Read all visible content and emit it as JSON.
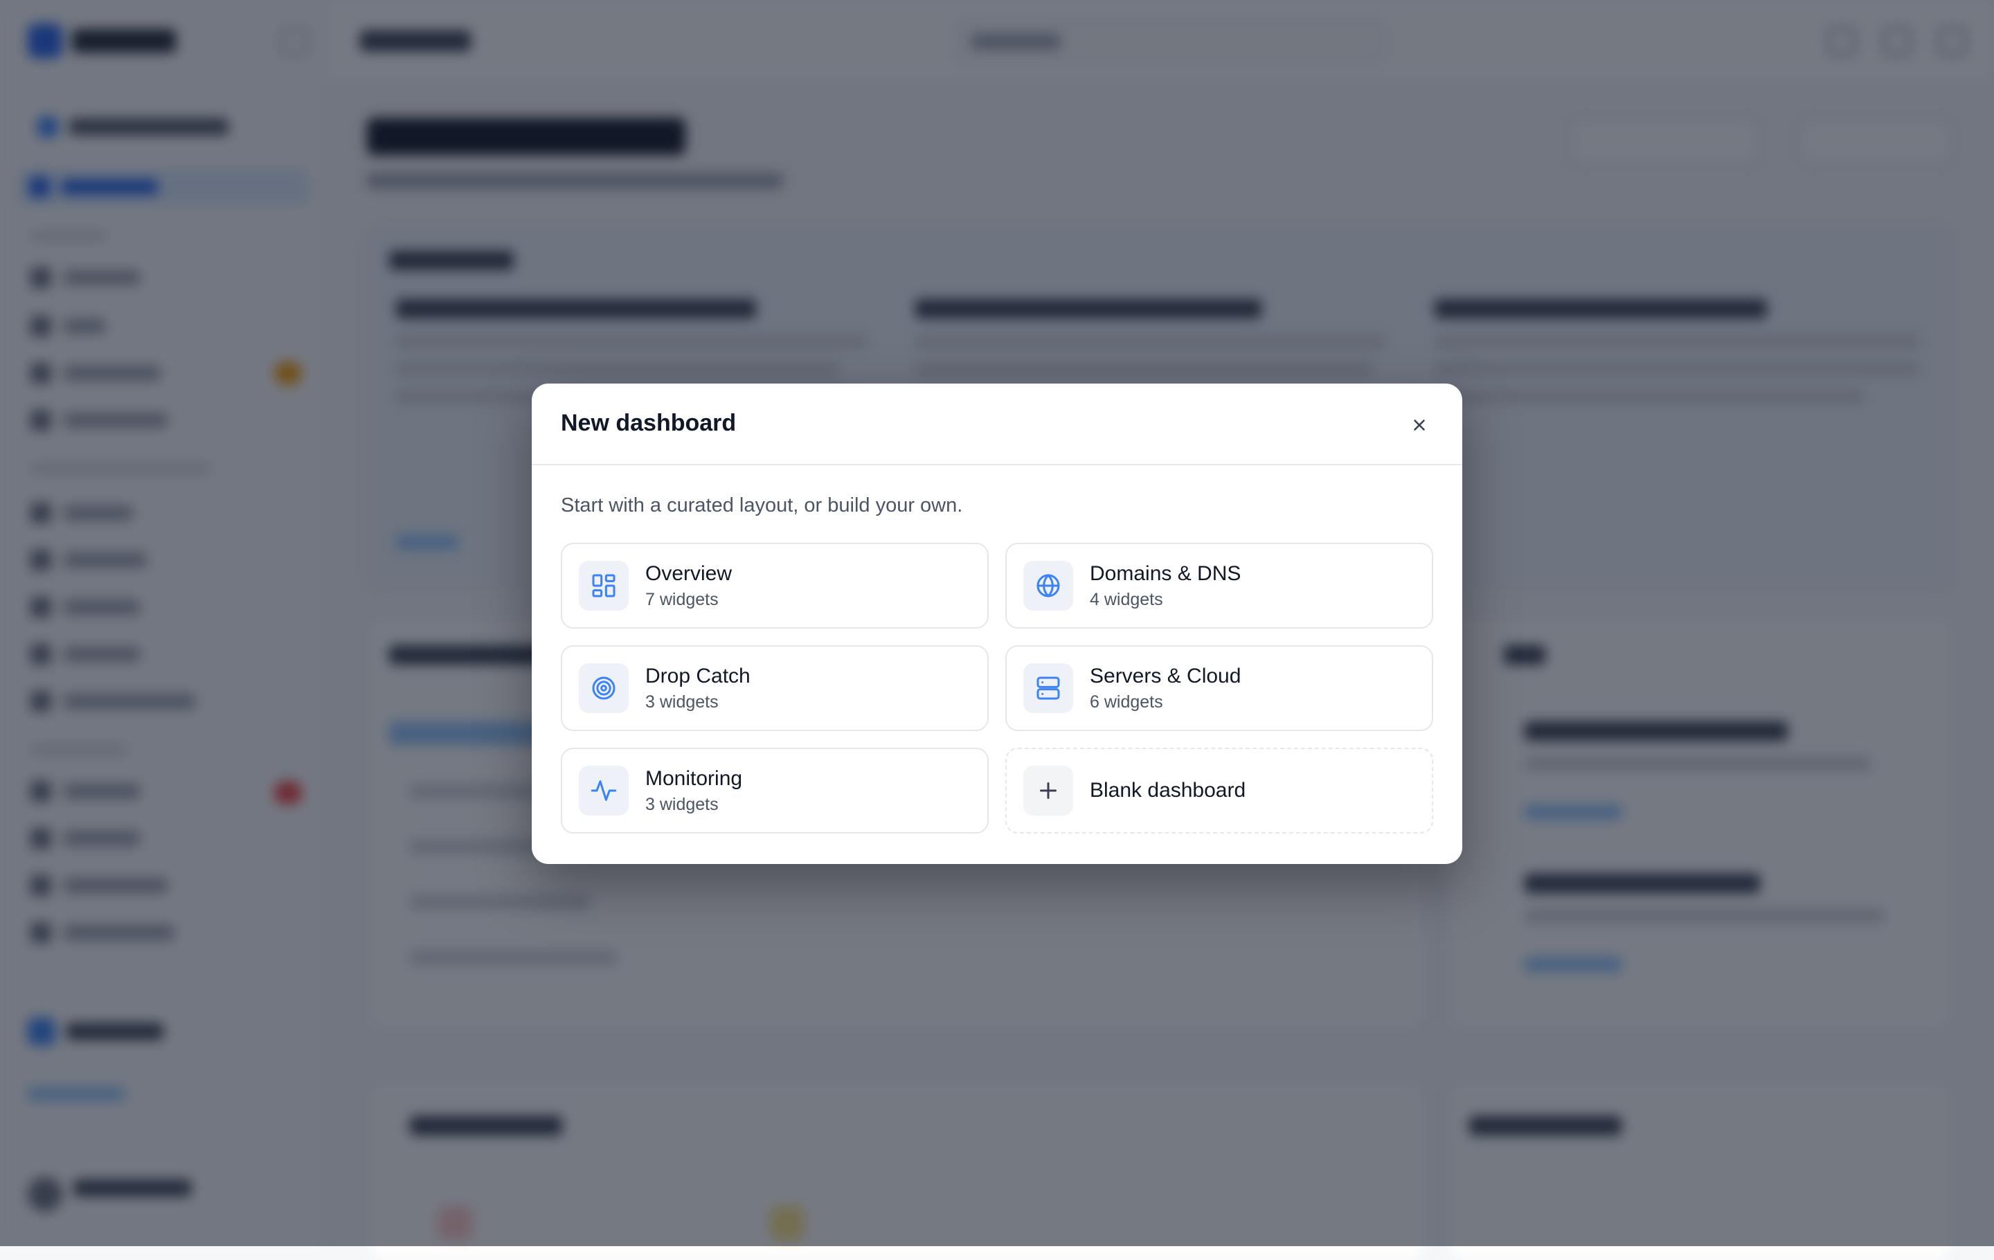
{
  "colors": {
    "accent": "#2563eb",
    "icon_blue": "#3b82f6",
    "icon_bg": "#eef2f8",
    "border": "#e5e7eb",
    "overlay": "rgba(17,24,39,0.58)"
  },
  "modal": {
    "title": "New dashboard",
    "description": "Start with a curated layout, or build your own.",
    "close_icon": "close-icon",
    "templates": [
      {
        "name": "Overview",
        "count": "7 widgets",
        "icon": "layout-grid-icon"
      },
      {
        "name": "Domains & DNS",
        "count": "4 widgets",
        "icon": "globe-icon"
      },
      {
        "name": "Drop Catch",
        "count": "3 widgets",
        "icon": "target-icon"
      },
      {
        "name": "Servers & Cloud",
        "count": "6 widgets",
        "icon": "server-icon"
      },
      {
        "name": "Monitoring",
        "count": "3 widgets",
        "icon": "activity-icon"
      }
    ],
    "blank": {
      "name": "Blank dashboard",
      "icon": "plus-icon"
    }
  }
}
